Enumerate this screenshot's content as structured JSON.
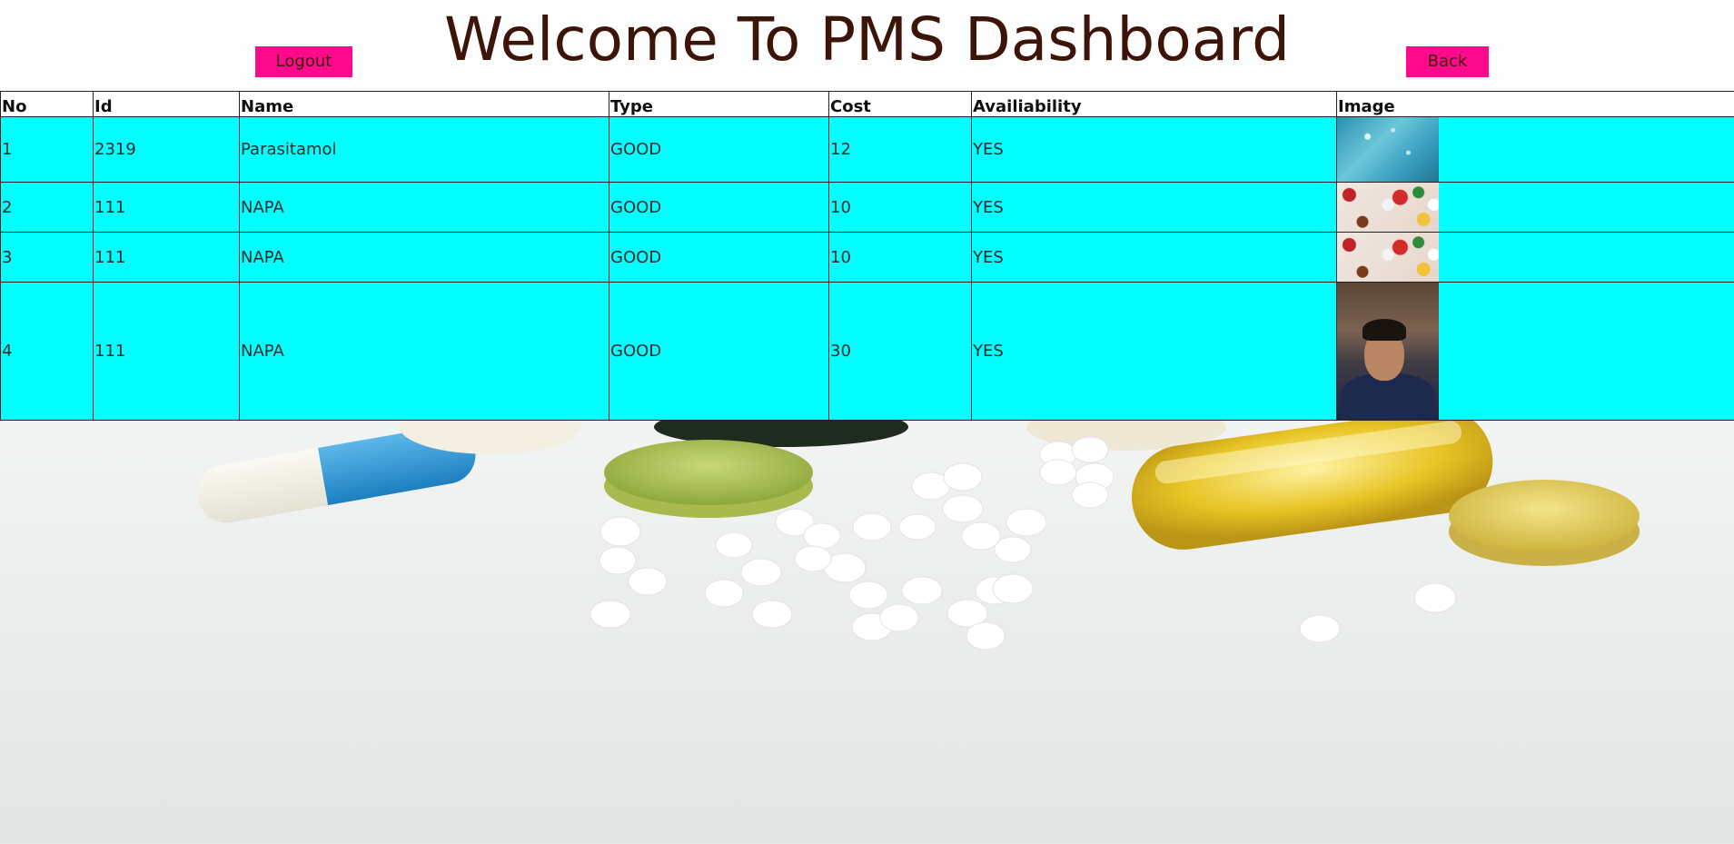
{
  "page": {
    "title": "Welcome To PMS Dashboard"
  },
  "buttons": {
    "logout": "Logout",
    "back": "Back"
  },
  "colors": {
    "button": "#ff0a8c",
    "row_background": "#00ffff",
    "title_text": "#3d1408"
  },
  "table": {
    "headers": [
      "No",
      "Id",
      "Name",
      "Type",
      "Cost",
      "Availiability",
      "Image"
    ],
    "rows": [
      {
        "no": "1",
        "id": "2319",
        "name": "Parasitamol",
        "type": "GOOD",
        "cost": "12",
        "availability": "YES",
        "image": "blue-medical-thumbnail"
      },
      {
        "no": "2",
        "id": "111",
        "name": "NAPA",
        "type": "GOOD",
        "cost": "10",
        "availability": "YES",
        "image": "colorful-pills-thumbnail"
      },
      {
        "no": "3",
        "id": "111",
        "name": "NAPA",
        "type": "GOOD",
        "cost": "10",
        "availability": "YES",
        "image": "colorful-pills-thumbnail"
      },
      {
        "no": "4",
        "id": "111",
        "name": "NAPA",
        "type": "GOOD",
        "cost": "30",
        "availability": "YES",
        "image": "person-photo-thumbnail"
      }
    ]
  }
}
